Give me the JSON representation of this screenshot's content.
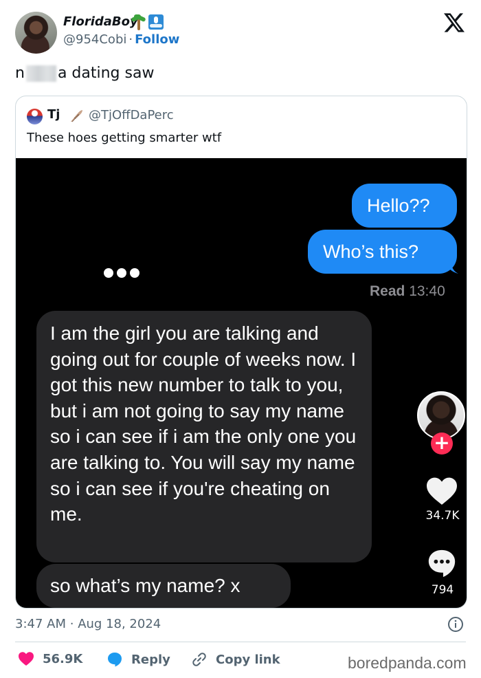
{
  "author": {
    "name": "FloridaBoy",
    "emojis": [
      "palm-tree-icon",
      "surfer-icon"
    ],
    "handle": "@954Cobi",
    "separator": "·",
    "follow_label": "Follow"
  },
  "tweet": {
    "text_prefix": "n",
    "text_suffix": "a dating saw"
  },
  "quote": {
    "name": "Tj",
    "handle": "@TjOffDaPerc",
    "text": "These hoes getting smarter wtf",
    "screenshot": {
      "outgoing": [
        "Hello??",
        "Who’s this?"
      ],
      "read_label": "Read",
      "read_time": "13:40",
      "incoming": [
        "I am the girl you are talking and going out for couple of weeks now. I got this new number to talk to you, but i am not going to say my name so i can see if i am the only one you are talking to. You will say my name so i can see if you're cheating on me.",
        "so what’s my name? x"
      ],
      "tiktok": {
        "plus": "+",
        "likes": "34.7K",
        "comments": "794"
      }
    }
  },
  "meta": {
    "time": "3:47 AM",
    "separator": "·",
    "date": "Aug 18, 2024"
  },
  "actions": {
    "likes": "56.9K",
    "reply_label": "Reply",
    "copy_label": "Copy link"
  },
  "watermark": "boredpanda.com",
  "colors": {
    "like": "#f91880",
    "reply": "#1d9bf0",
    "imessage_blue": "#1f8af5",
    "tiktok_red": "#fe2c55"
  }
}
